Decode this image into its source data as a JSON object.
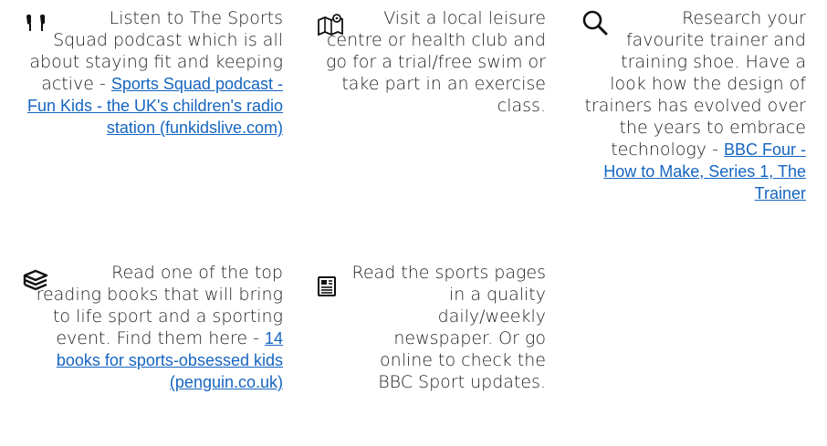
{
  "cards": [
    {
      "icon": "earbuds-icon",
      "text": "Listen to The Sports Squad podcast which is all about staying fit and keeping active - ",
      "link": "Sports Squad podcast - Fun Kids - the UK's children's radio station (funkidslive.com)"
    },
    {
      "icon": "map-location-icon",
      "text": "Visit a local leisure centre or health club and go for a trial/free swim or take part in an exercise class.",
      "link": ""
    },
    {
      "icon": "search-icon",
      "text": "Research your favourite trainer and training shoe. Have a look how the design of trainers has evolved over the years to embrace technology - ",
      "link": "BBC Four - How to Make, Series 1, The Trainer"
    },
    {
      "icon": "books-icon",
      "text": "Read one of the top reading books that will bring to life sport and a sporting event. Find them here - ",
      "link": "14 books for sports-obsessed kids (penguin.co.uk)"
    },
    {
      "icon": "newspaper-icon",
      "text": "Read the sports pages in a quality daily/weekly newspaper. Or go online to check the BBC Sport updates.",
      "link": ""
    }
  ]
}
